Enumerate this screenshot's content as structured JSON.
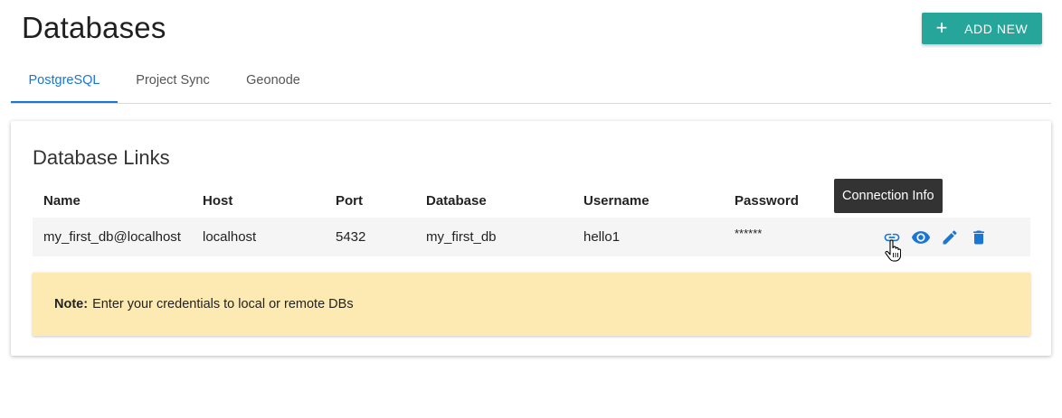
{
  "page": {
    "title": "Databases",
    "add_button": {
      "icon": "plus-icon",
      "label": "ADD NEW"
    }
  },
  "tabs": [
    {
      "label": "PostgreSQL",
      "active": true
    },
    {
      "label": "Project Sync",
      "active": false
    },
    {
      "label": "Geonode",
      "active": false
    }
  ],
  "card": {
    "title": "Database Links",
    "columns": [
      "Name",
      "Host",
      "Port",
      "Database",
      "Username",
      "Password"
    ],
    "rows": [
      {
        "name": "my_first_db@localhost",
        "host": "localhost",
        "port": "5432",
        "database": "my_first_db",
        "username": "hello1",
        "password": "******",
        "actions": [
          "link-icon",
          "eye-icon",
          "pencil-icon",
          "trash-icon"
        ]
      }
    ],
    "tooltip": "Connection Info",
    "note": {
      "label": "Note:",
      "text": "Enter your credentials to local or remote DBs"
    }
  },
  "colors": {
    "accent": "#26a69a",
    "tab_active": "#1976d2",
    "icon": "#1976d2",
    "note_bg": "#fdeab3",
    "tooltip_bg": "#333333"
  }
}
